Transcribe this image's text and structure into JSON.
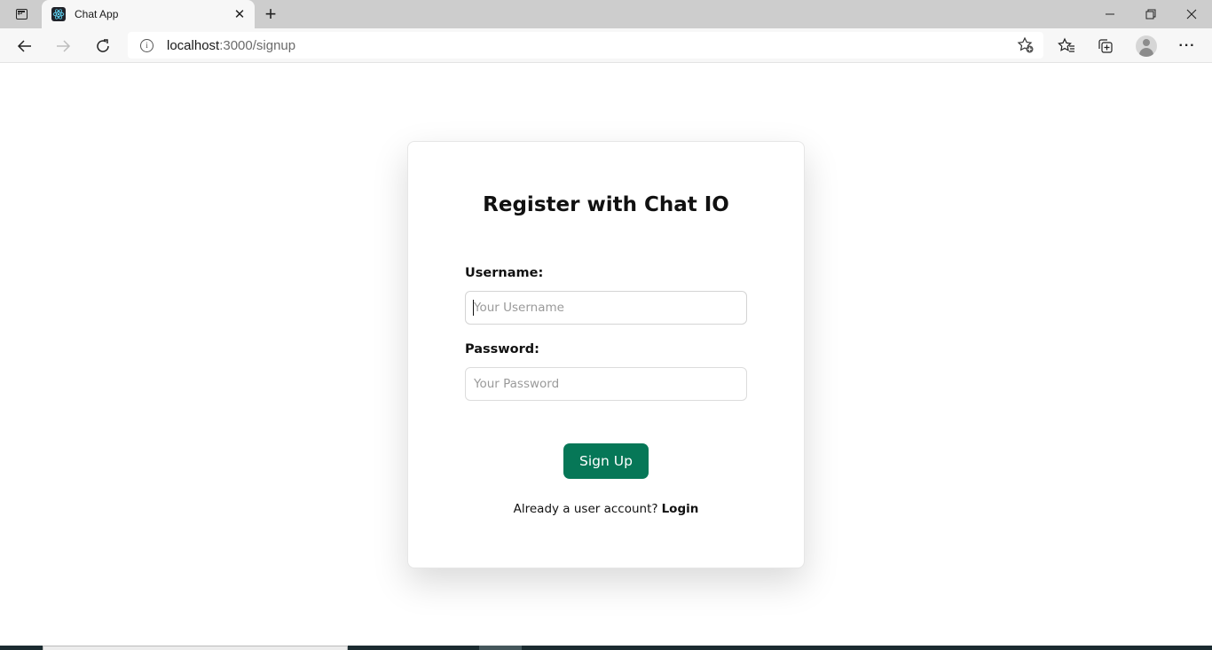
{
  "browser": {
    "tab": {
      "title": "Chat App",
      "favicon": "react-logo-icon"
    },
    "address_bar": {
      "host": "localhost",
      "path": ":3000/signup"
    },
    "window_controls": [
      "minimize",
      "restore",
      "close"
    ],
    "toolbar_icons": [
      "add-favorite-icon",
      "favorites-icon",
      "collections-icon",
      "profile-icon",
      "more-icon"
    ]
  },
  "signup": {
    "title": "Register with Chat IO",
    "username": {
      "label": "Username:",
      "placeholder": "Your Username",
      "value": ""
    },
    "password": {
      "label": "Password:",
      "placeholder": "Your Password",
      "value": ""
    },
    "submit_label": "Sign Up",
    "login_prompt": "Already a user account?",
    "login_link": "Login"
  },
  "colors": {
    "primary_button": "#067757",
    "text": "#111111"
  }
}
